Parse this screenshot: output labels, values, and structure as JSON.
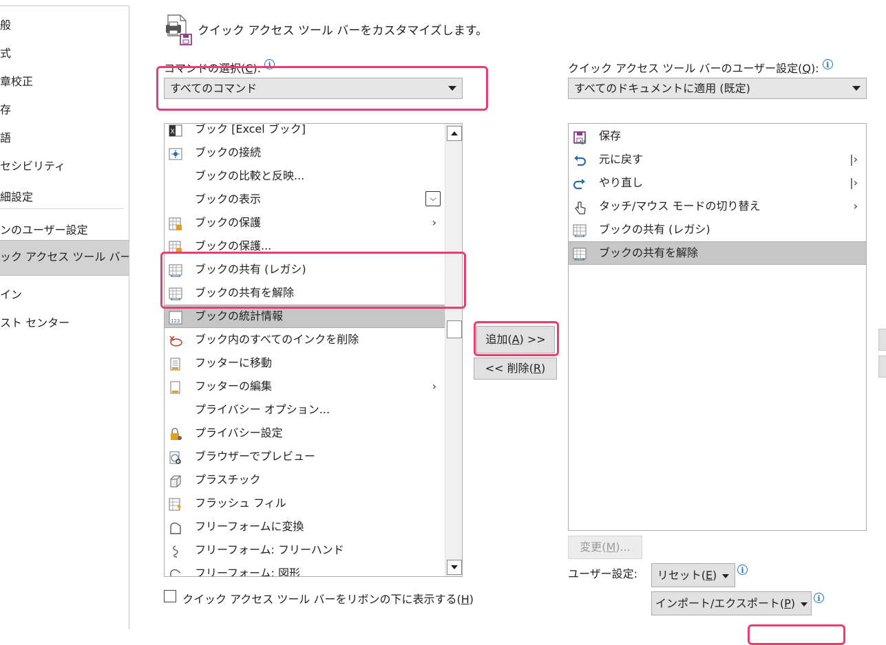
{
  "nav": {
    "items": [
      {
        "label": "般"
      },
      {
        "label": "式"
      },
      {
        "label": "章校正"
      },
      {
        "label": "存"
      },
      {
        "label": "語"
      },
      {
        "label": "セシビリティ"
      },
      {
        "label": "細設定"
      },
      {
        "label": "ンのユーザー設定"
      },
      {
        "label": "ック アクセス ツール バー"
      },
      {
        "label": "イン"
      },
      {
        "label": "スト センター"
      }
    ]
  },
  "header": {
    "title": "クイック アクセス ツール バーをカスタマイズします。"
  },
  "commands": {
    "label_prefix": "コマンドの選択(",
    "label_key": "C",
    "label_suffix": "):",
    "selected": "すべてのコマンド",
    "items": [
      {
        "label": "ブック [Excel ブック]",
        "icon": "excel-workbook-icon"
      },
      {
        "label": "ブックの接続",
        "icon": "workbook-connections-icon"
      },
      {
        "label": "ブックの比較と反映...",
        "icon": ""
      },
      {
        "label": "ブックの表示",
        "icon": "",
        "trailing": "⌵"
      },
      {
        "label": "ブックの保護",
        "icon": "protect-workbook-icon",
        "trailing": "›"
      },
      {
        "label": "ブックの保護...",
        "icon": "protect-workbook-icon"
      },
      {
        "label": "ブックの共有 (レガシ)",
        "icon": "share-workbook-icon"
      },
      {
        "label": "ブックの共有を解除",
        "icon": "unshare-workbook-icon"
      },
      {
        "label": "ブックの統計情報",
        "icon": "workbook-statistics-icon"
      },
      {
        "label": "ブック内のすべてのインクを削除",
        "icon": "delete-ink-icon"
      },
      {
        "label": "フッターに移動",
        "icon": "go-to-footer-icon"
      },
      {
        "label": "フッターの編集",
        "icon": "edit-footer-icon",
        "trailing": "›"
      },
      {
        "label": "プライバシー オプション...",
        "icon": ""
      },
      {
        "label": "プライバシー設定",
        "icon": "privacy-settings-icon"
      },
      {
        "label": "ブラウザーでプレビュー",
        "icon": "browser-preview-icon"
      },
      {
        "label": "プラスチック",
        "icon": "plastic-icon"
      },
      {
        "label": "フラッシュ フィル",
        "icon": "flash-fill-icon"
      },
      {
        "label": "フリーフォームに変換",
        "icon": "convert-freeform-icon"
      },
      {
        "label": "フリーフォーム: フリーハンド",
        "icon": "freehand-icon"
      },
      {
        "label": "フリーフォーム: 図形",
        "icon": "freeform-shape-icon"
      }
    ]
  },
  "qat": {
    "label_prefix": "クイック アクセス ツール バーのユーザー設定(",
    "label_key": "Q",
    "label_suffix": "):",
    "selected": "すべてのドキュメントに適用 (既定)",
    "items": [
      {
        "label": "保存",
        "icon": "save-icon"
      },
      {
        "label": "元に戻す",
        "icon": "undo-icon",
        "trailing": "|›"
      },
      {
        "label": "やり直し",
        "icon": "redo-icon",
        "trailing": "|›"
      },
      {
        "label": "タッチ/マウス モードの切り替え",
        "icon": "touch-mouse-mode-icon",
        "trailing": "›"
      },
      {
        "label": "ブックの共有 (レガシ)",
        "icon": "share-workbook-icon"
      },
      {
        "label": "ブックの共有を解除",
        "icon": "unshare-workbook-icon"
      }
    ]
  },
  "buttons": {
    "add_prefix": "追加(",
    "add_key": "A",
    "add_suffix": ") >>",
    "remove_prefix": "<< 削除(",
    "remove_key": "R",
    "remove_suffix": ")",
    "modify_prefix": "変更(",
    "modify_key": "M",
    "modify_suffix": ")...",
    "customizations_label": "ユーザー設定:",
    "reset_prefix": "リセット(",
    "reset_key": "E",
    "reset_suffix": ")",
    "import_export_prefix": "インポート/エクスポート(",
    "import_export_key": "P",
    "import_export_suffix": ")"
  },
  "checkbox": {
    "label_prefix": "クイック アクセス ツール バーをリボンの下に表示する(",
    "label_key": "H",
    "label_suffix": ")",
    "checked": false
  },
  "colors": {
    "highlight": "#ea3d6e",
    "selected_row": "#c6c6c6",
    "info": "#1a73c9"
  }
}
